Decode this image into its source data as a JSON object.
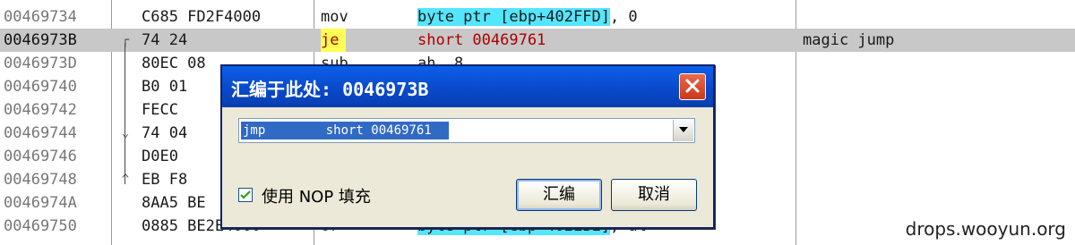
{
  "rows": [
    {
      "address": "00469734",
      "hex": "C685 FD2F4000",
      "mnemonic": "mov",
      "operand": "byte ptr [ebp+402FFD], 0",
      "comment": ""
    },
    {
      "address": "0046973B",
      "hex": "74 24",
      "mnemonic": "je",
      "operand": "short 00469761",
      "comment": "magic jump"
    },
    {
      "address": "0046973D",
      "hex": "80EC 08",
      "mnemonic": "sub",
      "operand": "ah, 8",
      "comment": ""
    },
    {
      "address": "00469740",
      "hex": "B0 01",
      "mnemonic": "",
      "operand": "",
      "comment": ""
    },
    {
      "address": "00469742",
      "hex": "FECC",
      "mnemonic": "",
      "operand": "",
      "comment": ""
    },
    {
      "address": "00469744",
      "hex": "74 04",
      "mnemonic": "",
      "operand": "",
      "comment": ""
    },
    {
      "address": "00469746",
      "hex": "D0E0",
      "mnemonic": "",
      "operand": "",
      "comment": ""
    },
    {
      "address": "00469748",
      "hex": "EB F8",
      "mnemonic": "",
      "operand": "",
      "comment": ""
    },
    {
      "address": "0046974A",
      "hex": "8AA5 BE",
      "mnemonic": "",
      "operand": "",
      "comment": ""
    },
    {
      "address": "00469750",
      "hex": "0885 BE2E4000",
      "mnemonic": "or",
      "operand": "byte ptr [ebp+402EBE], al",
      "comment": ""
    }
  ],
  "dialog": {
    "title": "汇编于此处: 0046973B",
    "instruction": "jmp        short 00469761",
    "fill_nop_label": "使用 NOP 填充",
    "fill_nop_checked": true,
    "assemble_button": "汇编",
    "cancel_button": "取消"
  },
  "watermark": "drops.wooyun.org",
  "colors": {
    "selected_row": "#c8c8c8",
    "operand_highlight": "#55e6ff",
    "jump_mnemonic_highlight": "#ffff55",
    "title_bar": "#0a48c8"
  }
}
